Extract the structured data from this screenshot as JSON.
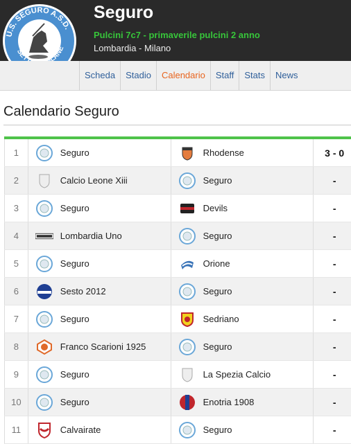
{
  "header": {
    "title": "Seguro",
    "subtitle": "Pulcini 7c7 - primaverile pulcini 2 anno",
    "region": "Lombardia - Milano",
    "logo_text": "U.S. SEGURO A.S.D. SETTIMO MILANESE"
  },
  "tabs": [
    {
      "label": "Scheda"
    },
    {
      "label": "Stadio"
    },
    {
      "label": "Calendario"
    },
    {
      "label": "Staff"
    },
    {
      "label": "Stats"
    },
    {
      "label": "News"
    }
  ],
  "active_tab": "Calendario",
  "section_title": "Calendario Seguro",
  "matches": [
    {
      "num": "1",
      "home": "Seguro",
      "away": "Rhodense",
      "score": "3 - 0"
    },
    {
      "num": "2",
      "home": "Calcio Leone Xiii",
      "away": "Seguro",
      "score": "-"
    },
    {
      "num": "3",
      "home": "Seguro",
      "away": "Devils",
      "score": "-"
    },
    {
      "num": "4",
      "home": "Lombardia Uno",
      "away": "Seguro",
      "score": "-"
    },
    {
      "num": "5",
      "home": "Seguro",
      "away": "Orione",
      "score": "-"
    },
    {
      "num": "6",
      "home": "Sesto 2012",
      "away": "Seguro",
      "score": "-"
    },
    {
      "num": "7",
      "home": "Seguro",
      "away": "Sedriano",
      "score": "-"
    },
    {
      "num": "8",
      "home": "Franco Scarioni 1925",
      "away": "Seguro",
      "score": "-"
    },
    {
      "num": "9",
      "home": "Seguro",
      "away": "La Spezia Calcio",
      "score": "-"
    },
    {
      "num": "10",
      "home": "Seguro",
      "away": "Enotria 1908",
      "score": "-"
    },
    {
      "num": "11",
      "home": "Calvairate",
      "away": "Seguro",
      "score": "-"
    }
  ],
  "colors": {
    "header_bg": "#2a2a2a",
    "subtitle": "#37c53a",
    "tab_link": "#2f5f9a",
    "tab_active": "#e8641e",
    "table_accent": "#4fc34a"
  }
}
